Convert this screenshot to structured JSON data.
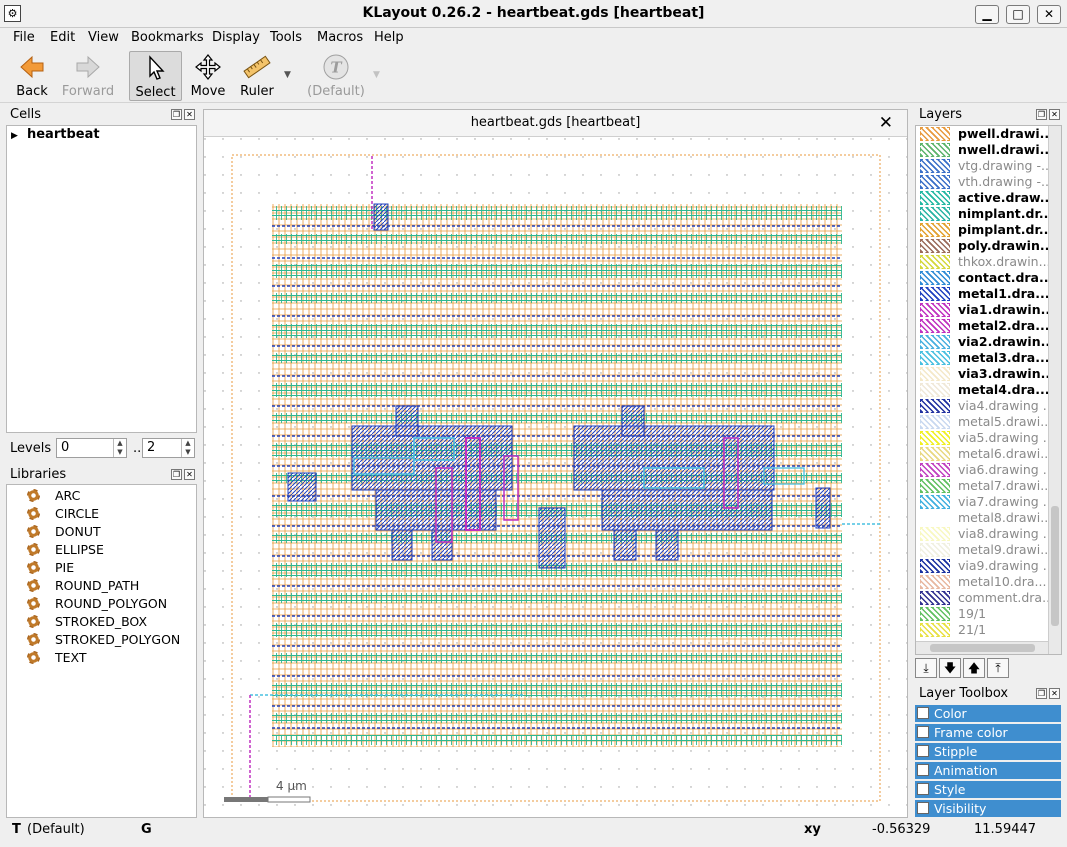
{
  "window": {
    "title": "KLayout 0.26.2 - heartbeat.gds [heartbeat]",
    "minimize": "▁",
    "maximize": "□",
    "close": "✕"
  },
  "menu": [
    "File",
    "Edit",
    "View",
    "Bookmarks",
    "Display",
    "Tools",
    "Macros",
    "Help"
  ],
  "toolbar": {
    "back": "Back",
    "forward": "Forward",
    "select": "Select",
    "move": "Move",
    "ruler": "Ruler",
    "default": "(Default)"
  },
  "cells": {
    "header": "Cells",
    "items": [
      "heartbeat"
    ]
  },
  "levels": {
    "label": "Levels",
    "from": "0",
    "sep": "..",
    "to": "2"
  },
  "libraries": {
    "header": "Libraries",
    "items": [
      "ARC",
      "CIRCLE",
      "DONUT",
      "ELLIPSE",
      "PIE",
      "ROUND_PATH",
      "ROUND_POLYGON",
      "STROKED_BOX",
      "STROKED_POLYGON",
      "TEXT"
    ]
  },
  "canvas": {
    "tab_title": "heartbeat.gds [heartbeat]",
    "scale_label": "4  µm"
  },
  "layers": {
    "header": "Layers",
    "items": [
      {
        "name": "pwell.drawi...",
        "visible": true,
        "color": "#e89a3c"
      },
      {
        "name": "nwell.drawi...",
        "visible": true,
        "color": "#5bb36a"
      },
      {
        "name": "vtg.drawing -...",
        "visible": false,
        "color": "#3a6fc8"
      },
      {
        "name": "vth.drawing -...",
        "visible": false,
        "color": "#3a6fc8"
      },
      {
        "name": "active.draw...",
        "visible": true,
        "color": "#22b8a2"
      },
      {
        "name": "nimplant.dr...",
        "visible": true,
        "color": "#28b4a4"
      },
      {
        "name": "pimplant.dr...",
        "visible": true,
        "color": "#e3a02e"
      },
      {
        "name": "poly.drawin...",
        "visible": true,
        "color": "#9a6a5a"
      },
      {
        "name": "thkox.drawin...",
        "visible": false,
        "color": "#d4d83a"
      },
      {
        "name": "contact.dra...",
        "visible": true,
        "color": "#2e8bd6"
      },
      {
        "name": "metal1.dra...",
        "visible": true,
        "color": "#2040c0"
      },
      {
        "name": "via1.drawin...",
        "visible": true,
        "color": "#c030c0"
      },
      {
        "name": "metal2.dra...",
        "visible": true,
        "color": "#c030c0"
      },
      {
        "name": "via2.drawin...",
        "visible": true,
        "color": "#48b0e0"
      },
      {
        "name": "metal3.dra...",
        "visible": true,
        "color": "#48c0e0"
      },
      {
        "name": "via3.drawin...",
        "visible": true,
        "color": "#f4e8c8"
      },
      {
        "name": "metal4.dra...",
        "visible": true,
        "color": "#f0e8d8"
      },
      {
        "name": "via4.drawing ...",
        "visible": false,
        "color": "#2030a0"
      },
      {
        "name": "metal5.drawi...",
        "visible": false,
        "color": "#c8d8f0"
      },
      {
        "name": "via5.drawing ...",
        "visible": false,
        "color": "#f0f020"
      },
      {
        "name": "metal6.drawi...",
        "visible": false,
        "color": "#e8d880"
      },
      {
        "name": "via6.drawing ...",
        "visible": false,
        "color": "#c040c0"
      },
      {
        "name": "metal7.drawi...",
        "visible": false,
        "color": "#60c060"
      },
      {
        "name": "via7.drawing ...",
        "visible": false,
        "color": "#40b0e0"
      },
      {
        "name": "metal8.drawi...",
        "visible": false,
        "color": "#ffffff"
      },
      {
        "name": "via8.drawing ...",
        "visible": false,
        "color": "#f8f8c0"
      },
      {
        "name": "metal9.drawi...",
        "visible": false,
        "color": "#f0f0e0"
      },
      {
        "name": "via9.drawing ...",
        "visible": false,
        "color": "#1830a0"
      },
      {
        "name": "metal10.dra...",
        "visible": false,
        "color": "#e8b8a0"
      },
      {
        "name": "comment.dra...",
        "visible": false,
        "color": "#303090"
      },
      {
        "name": "19/1",
        "visible": false,
        "color": "#60c060"
      },
      {
        "name": "21/1",
        "visible": false,
        "color": "#e8e040"
      }
    ]
  },
  "layer_toolbox": {
    "header": "Layer Toolbox",
    "items": [
      "Color",
      "Frame color",
      "Stipple",
      "Animation",
      "Style",
      "Visibility"
    ]
  },
  "status": {
    "mode_key": "T",
    "mode_value": "(Default)",
    "g": "G",
    "xy_label": "xy",
    "x": "-0.56329",
    "y": "11.59447"
  },
  "colors": {
    "accent": "#3f8ecf"
  }
}
